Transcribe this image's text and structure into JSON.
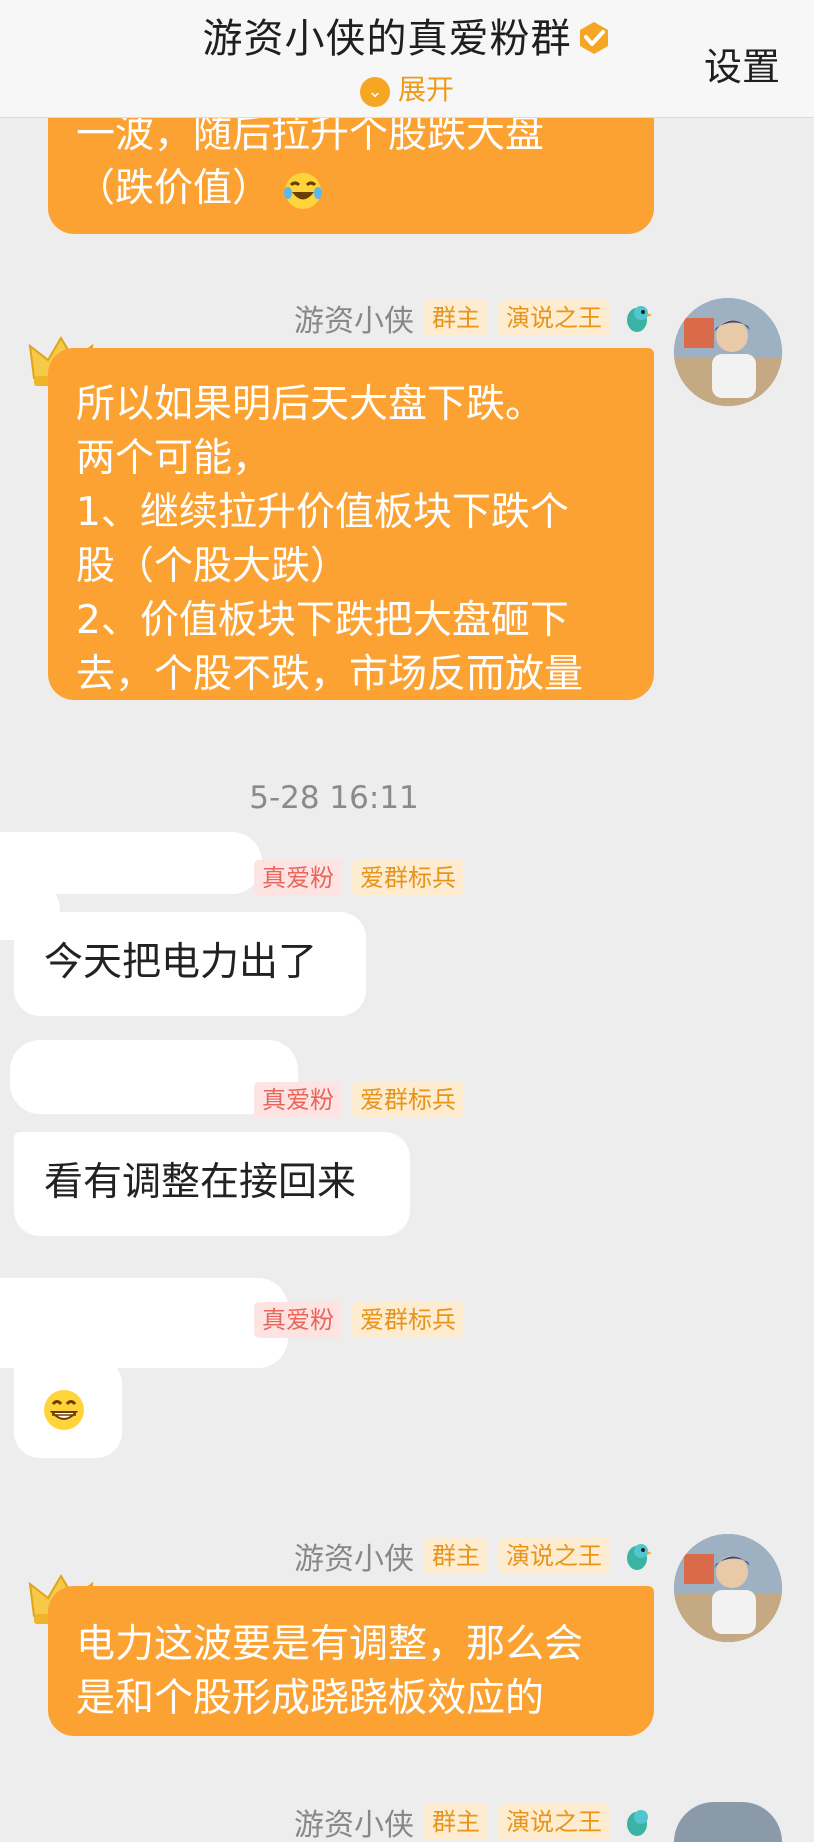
{
  "header": {
    "title": "游资小侠的真爱粉群",
    "expand_label": "展开",
    "settings_label": "设置"
  },
  "messages": [
    {
      "lines": [
        "一波，随后拉升个股跌大盘",
        "（跌价值）"
      ]
    },
    {
      "sender": "游资小侠",
      "badges": [
        "群主",
        "演说之王"
      ],
      "lines": [
        "所以如果明后天大盘下跌。",
        "两个可能，",
        "1、继续拉升价值板块下跌个",
        "股（个股大跌）",
        "2、价值板块下跌把大盘砸下",
        "去，个股不跌，市场反而放量"
      ]
    },
    {
      "timestamp": "5-28 16:11"
    },
    {
      "badges": [
        "真爱粉",
        "爱群标兵"
      ],
      "text": "今天把电力出了"
    },
    {
      "badges": [
        "真爱粉",
        "爱群标兵"
      ],
      "text": "看有调整在接回来"
    },
    {
      "badges": [
        "真爱粉",
        "爱群标兵"
      ],
      "emoji": "grinning-face"
    },
    {
      "sender": "游资小侠",
      "badges": [
        "群主",
        "演说之王"
      ],
      "lines": [
        "电力这波要是有调整，那么会",
        "是和个股形成跷跷板效应的"
      ]
    },
    {
      "sender": "游资小侠",
      "badges": [
        "群主",
        "演说之王"
      ]
    }
  ],
  "colors": {
    "bubble_orange": "#fba232",
    "background": "#ededed",
    "accent": "#f09a1d"
  }
}
